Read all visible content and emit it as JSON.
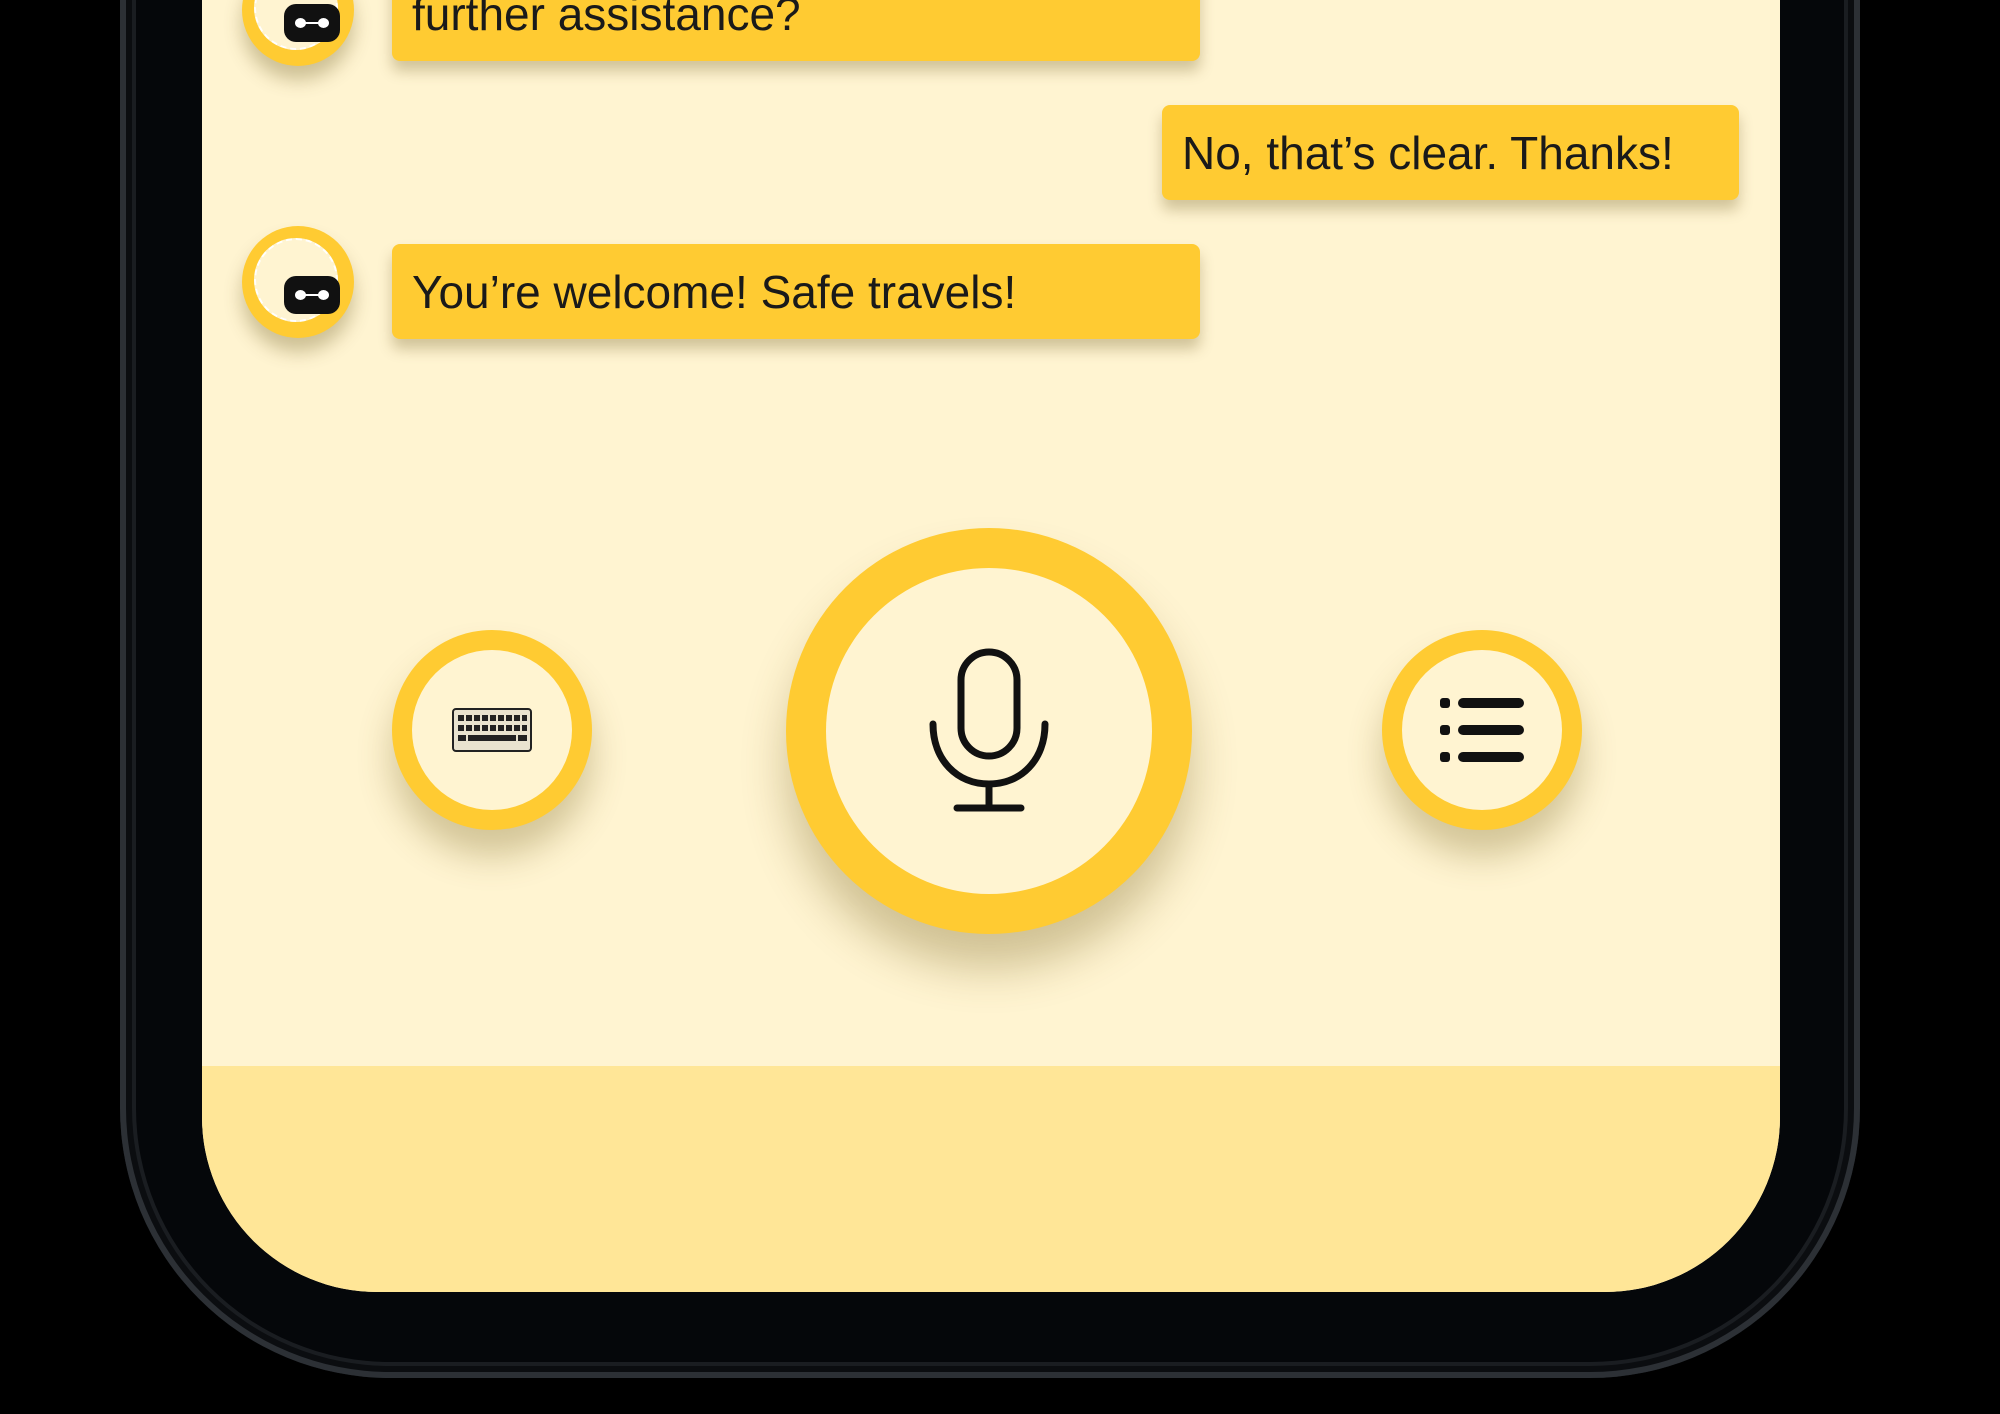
{
  "colors": {
    "background": "#000000",
    "screen": "#FFF4D1",
    "accent": "#FFCB32",
    "bottom_bar": "#FFE697",
    "text": "#1a1a1a"
  },
  "messages": [
    {
      "sender": "bot",
      "text": "further assistance?",
      "avatar_icon": "bot-icon"
    },
    {
      "sender": "user",
      "text": "No, that’s clear. Thanks!"
    },
    {
      "sender": "bot",
      "text": "You’re welcome! Safe travels!",
      "avatar_icon": "bot-icon"
    }
  ],
  "controls": {
    "keyboard": {
      "icon": "keyboard-icon"
    },
    "microphone": {
      "icon": "microphone-icon"
    },
    "menu": {
      "icon": "list-icon"
    }
  }
}
